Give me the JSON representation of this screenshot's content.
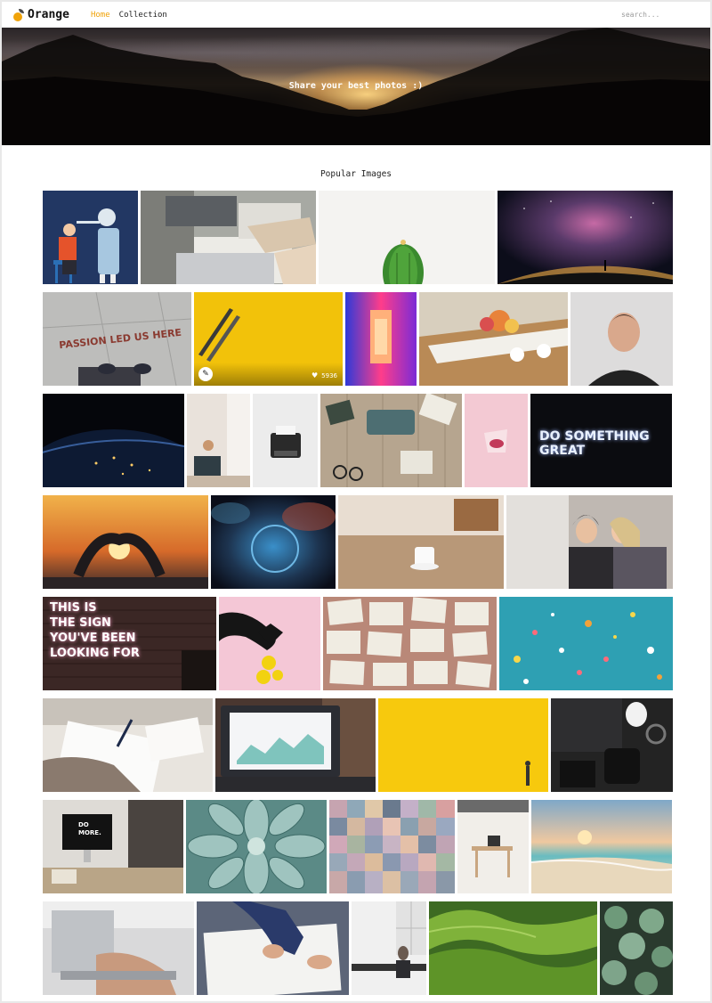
{
  "header": {
    "logo_text": "Orange",
    "nav": [
      {
        "label": "Home",
        "active": true
      },
      {
        "label": "Collection",
        "active": false
      }
    ],
    "search_placeholder": "search..."
  },
  "hero": {
    "title": "Share your best photos :)"
  },
  "gallery": {
    "title": "Popular Images",
    "featured": {
      "likes": "5936",
      "heart_icon": "heart-icon",
      "avatar_icon": "author-avatar"
    },
    "photo_text": {
      "passion": "PASSION LED US HERE",
      "neon": "DO SOMETHING GREAT",
      "sign": [
        "THIS IS",
        "THE SIGN",
        "YOU'VE BEEN",
        "LOOKING FOR"
      ],
      "domore": [
        "DO",
        "MORE."
      ]
    },
    "accent": "#f0a30a"
  }
}
